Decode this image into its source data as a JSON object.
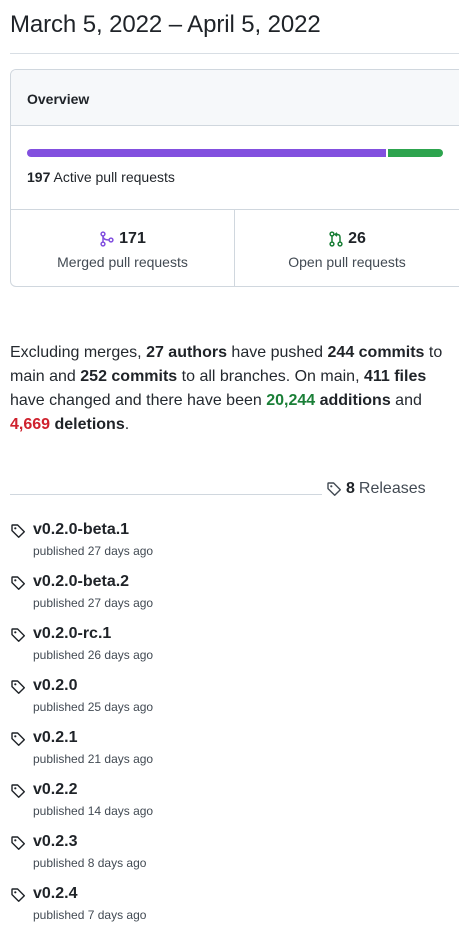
{
  "header": {
    "date_range": "March 5, 2022 – April 5, 2022"
  },
  "overview": {
    "title": "Overview",
    "progress": {
      "merged_share": 0.868,
      "open_share": 0.132,
      "merged_color": "#8250df",
      "open_color": "#2da44e"
    },
    "active_count": "197",
    "active_label": "Active pull requests",
    "merged": {
      "count": "171",
      "label": "Merged pull requests",
      "icon": "git-merge-icon"
    },
    "open": {
      "count": "26",
      "label": "Open pull requests",
      "icon": "git-pull-request-icon"
    }
  },
  "summary": {
    "t1": "Excluding merges, ",
    "authors": "27 authors",
    "t2": " have pushed ",
    "commits_main": "244 commits",
    "t3": " to main and ",
    "commits_all": "252 commits",
    "t4": " to all branches. On main, ",
    "files": "411 files",
    "t5": " have changed and there have been ",
    "additions_num": "20,244",
    "additions_word": " additions",
    "t6": " and ",
    "deletions_num": "4,669",
    "deletions_word": " deletions",
    "t7": "."
  },
  "releases": {
    "count": "8",
    "label": "Releases",
    "icon": "tag-icon",
    "items": [
      {
        "name": "v0.2.0-beta.1",
        "published": "published 27 days ago"
      },
      {
        "name": "v0.2.0-beta.2",
        "published": "published 27 days ago"
      },
      {
        "name": "v0.2.0-rc.1",
        "published": "published 26 days ago"
      },
      {
        "name": "v0.2.0",
        "published": "published 25 days ago"
      },
      {
        "name": "v0.2.1",
        "published": "published 21 days ago"
      },
      {
        "name": "v0.2.2",
        "published": "published 14 days ago"
      },
      {
        "name": "v0.2.3",
        "published": "published 8 days ago"
      },
      {
        "name": "v0.2.4",
        "published": "published 7 days ago"
      }
    ]
  }
}
